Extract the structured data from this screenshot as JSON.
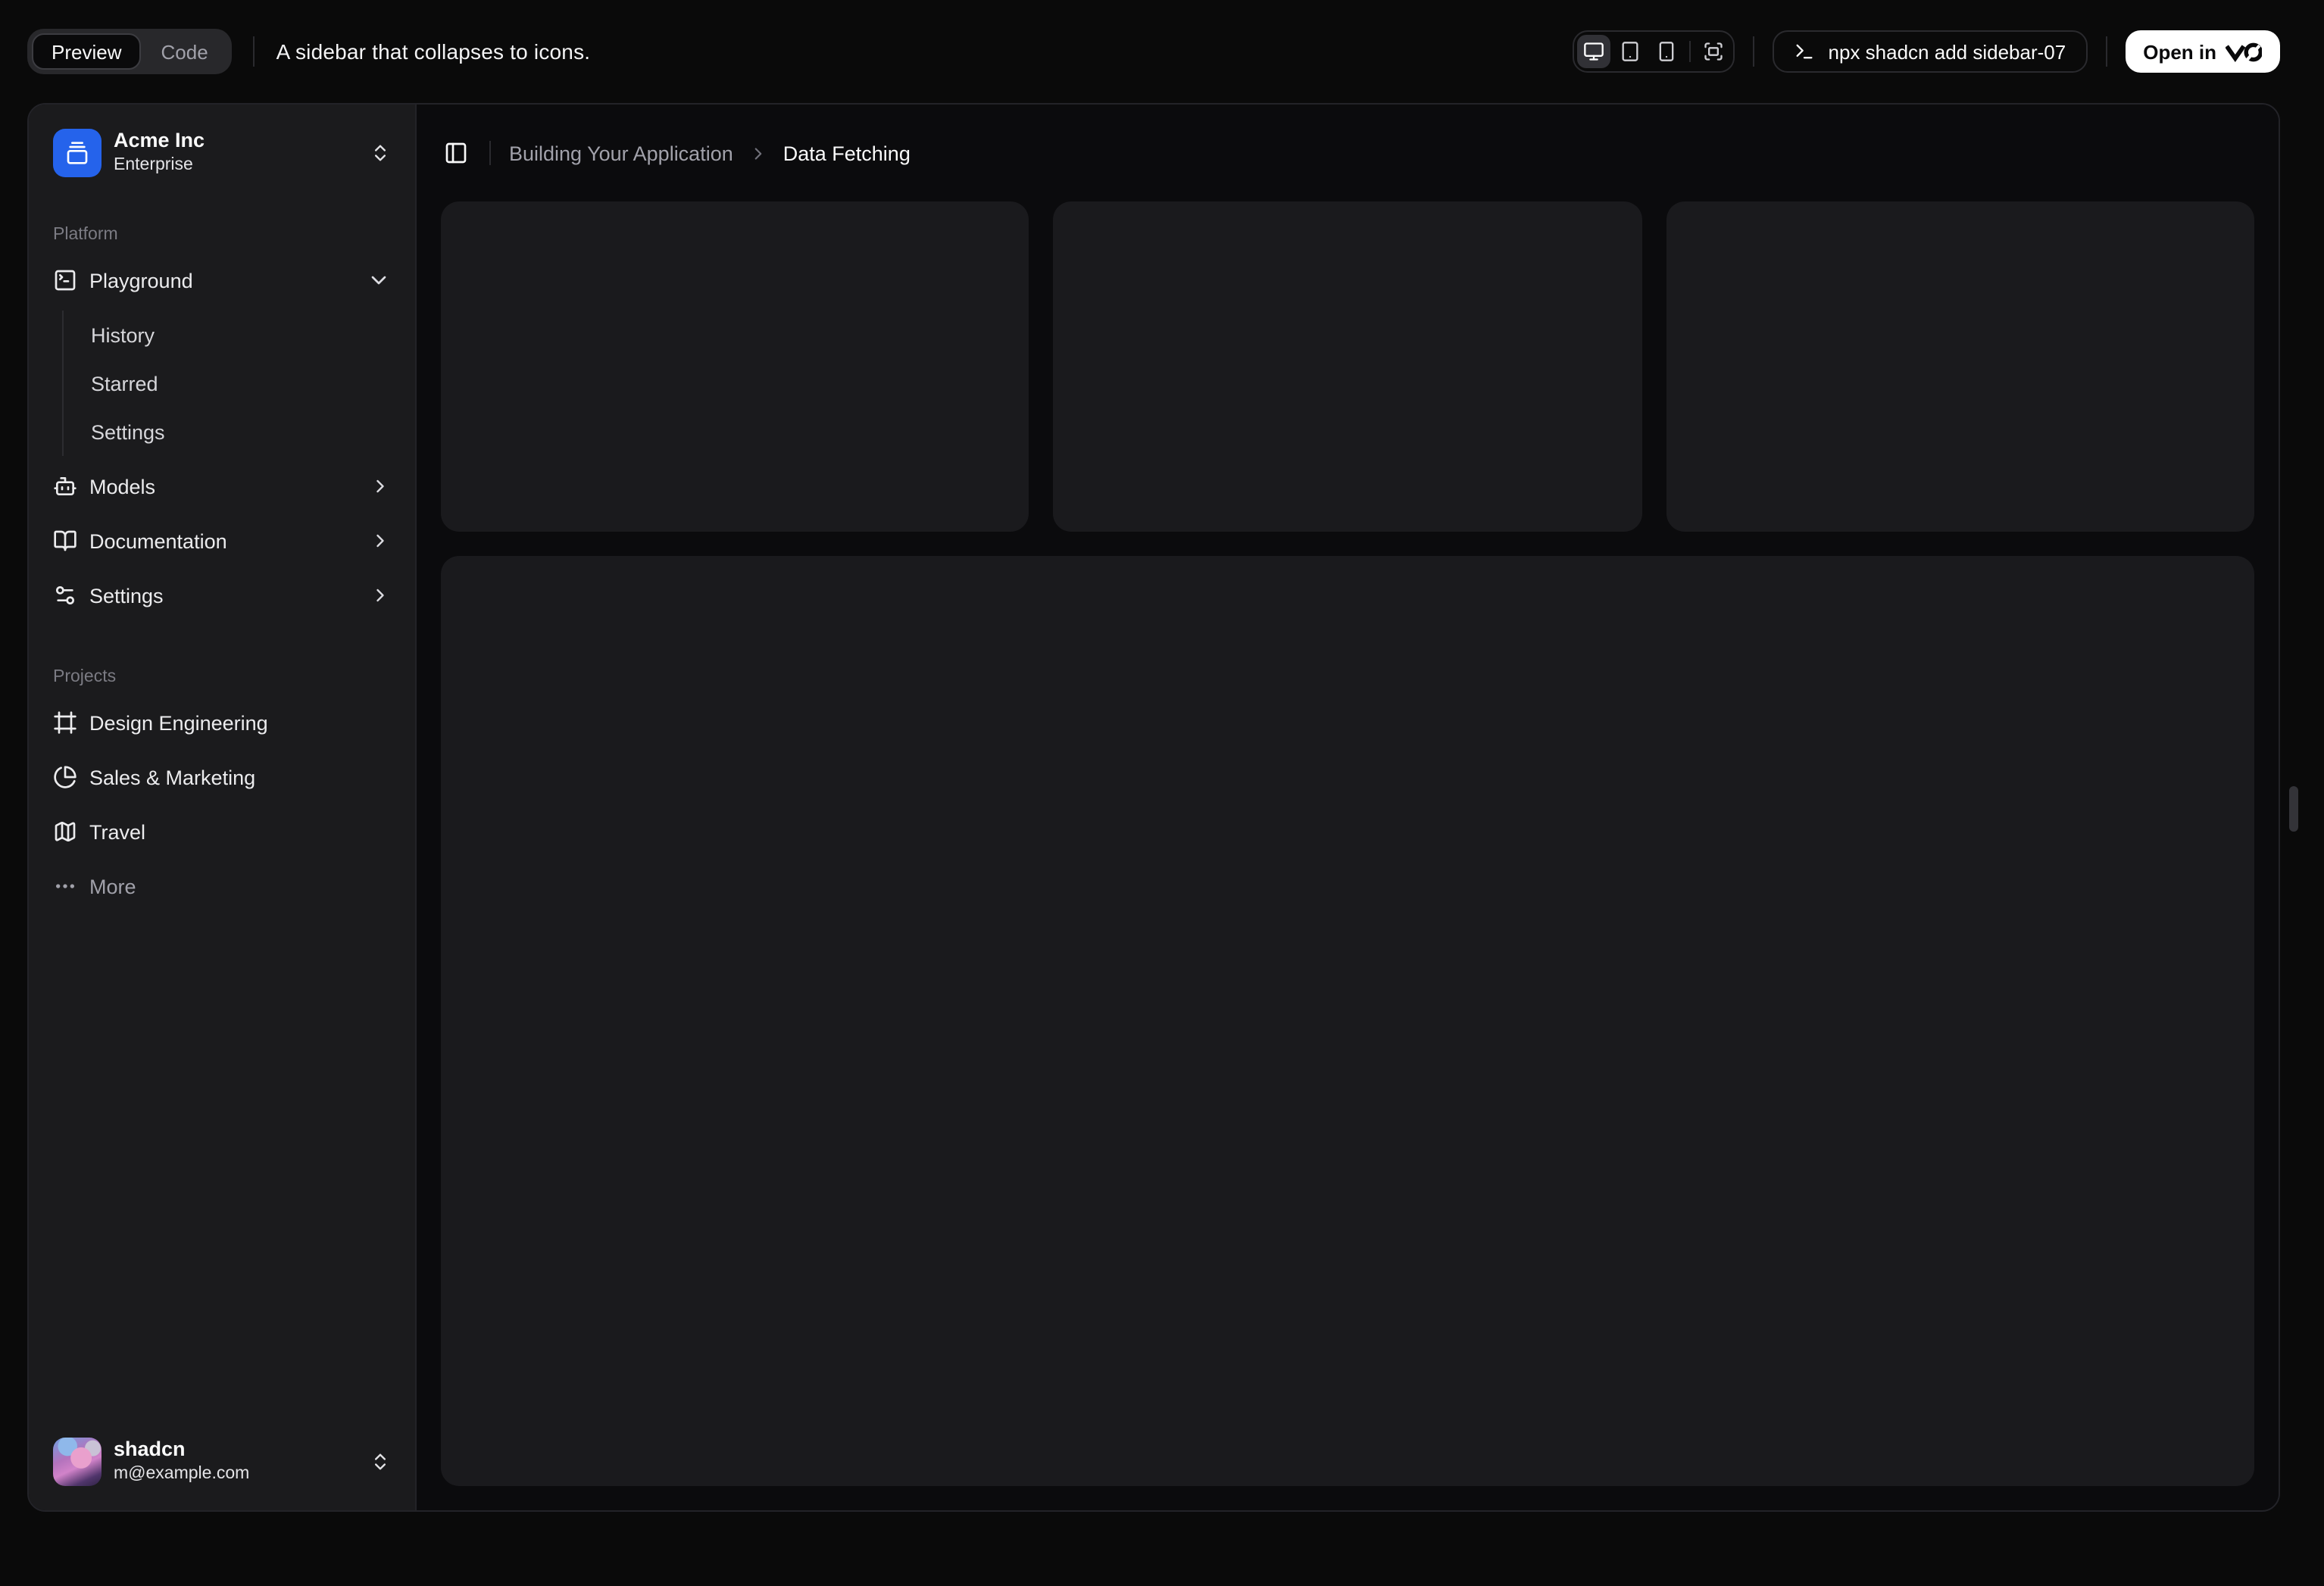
{
  "toolbar": {
    "tabs": [
      {
        "label": "Preview"
      },
      {
        "label": "Code"
      }
    ],
    "active_tab": "Preview",
    "description": "A sidebar that collapses to icons.",
    "devices": [
      "desktop",
      "tablet",
      "mobile",
      "fullscreen"
    ],
    "command": "npx shadcn add sidebar-07",
    "open_button": {
      "label": "Open in",
      "brand": "v0"
    }
  },
  "sidebar": {
    "team": {
      "name": "Acme Inc",
      "plan": "Enterprise"
    },
    "groups": [
      {
        "label": "Platform",
        "items": [
          {
            "label": "Playground",
            "icon": "terminal-square",
            "expanded": true,
            "children": [
              "History",
              "Starred",
              "Settings"
            ]
          },
          {
            "label": "Models",
            "icon": "bot"
          },
          {
            "label": "Documentation",
            "icon": "book-open"
          },
          {
            "label": "Settings",
            "icon": "settings-sliders"
          }
        ]
      },
      {
        "label": "Projects",
        "items": [
          {
            "label": "Design Engineering",
            "icon": "frame"
          },
          {
            "label": "Sales & Marketing",
            "icon": "pie-chart"
          },
          {
            "label": "Travel",
            "icon": "map"
          },
          {
            "label": "More",
            "icon": "ellipsis",
            "muted": true
          }
        ]
      }
    ],
    "user": {
      "name": "shadcn",
      "email": "m@example.com"
    }
  },
  "breadcrumb": {
    "section": "Building Your Application",
    "page": "Data Fetching"
  },
  "colors": {
    "accent_blue": "#2563eb",
    "page_bg": "#0a0a0a",
    "sidebar_bg": "#1b1b1d",
    "content_bg": "#0b0b0d",
    "card_bg": "#1a1a1d",
    "open_button_bg": "#ffffff"
  }
}
